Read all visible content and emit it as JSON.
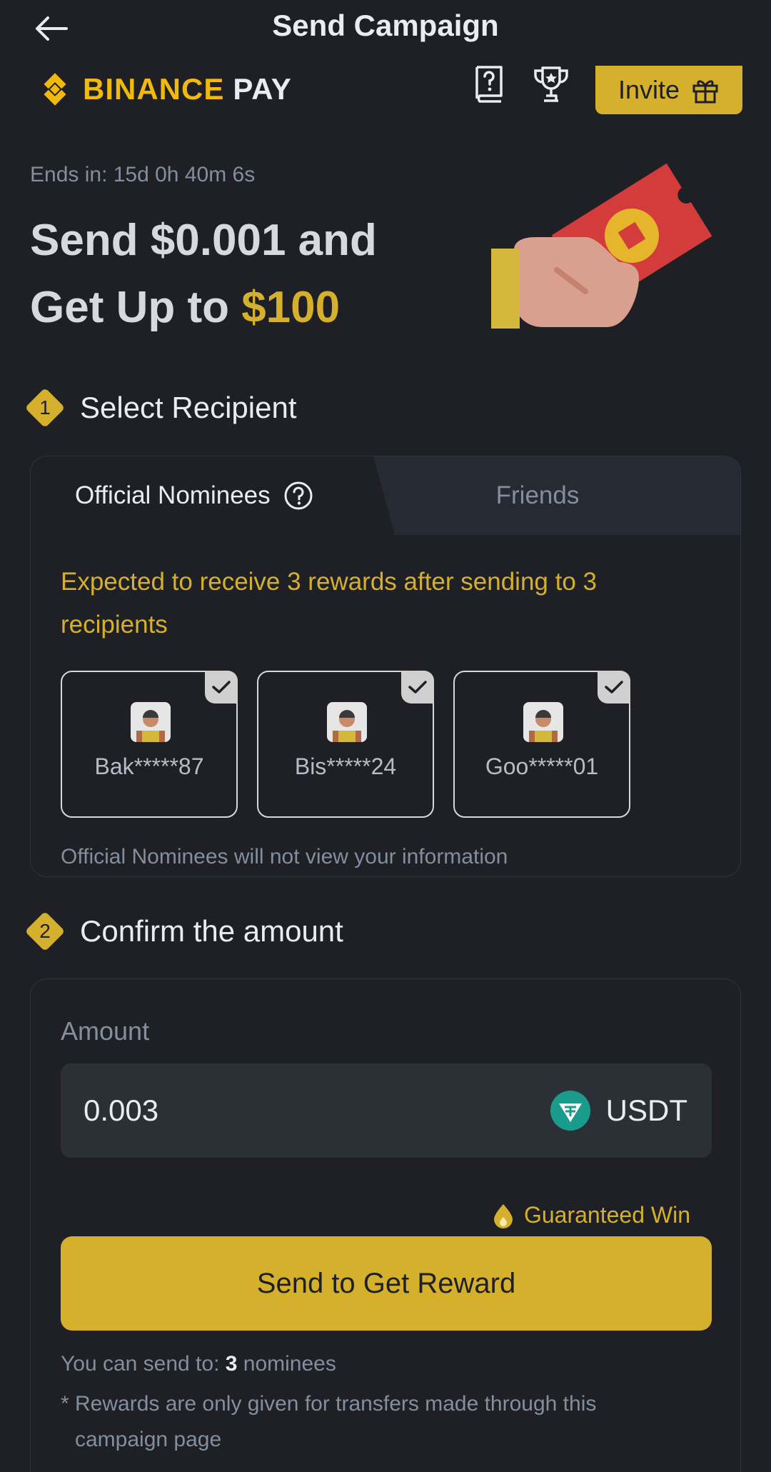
{
  "header": {
    "title": "Send Campaign"
  },
  "brand": {
    "name_primary": "BINANCE",
    "name_secondary": "PAY",
    "invite_label": "Invite"
  },
  "hero": {
    "ends_in": "Ends in: 15d 0h 40m 6s",
    "line1": "Send $0.001 and",
    "line2_prefix": "Get Up to ",
    "line2_highlight": "$100"
  },
  "step1": {
    "number": "1",
    "label": "Select Recipient"
  },
  "tabs": {
    "official": "Official Nominees",
    "friends": "Friends"
  },
  "recipients": {
    "expected": "Expected to receive 3 rewards after sending to 3 recipients",
    "nominees": [
      {
        "name": "Bak*****87"
      },
      {
        "name": "Bis*****24"
      },
      {
        "name": "Goo*****01"
      }
    ],
    "note": "Official Nominees will not view your information"
  },
  "step2": {
    "number": "2",
    "label": "Confirm the amount"
  },
  "amount": {
    "label": "Amount",
    "value": "0.003",
    "currency": "USDT",
    "guaranteed": "Guaranteed Win",
    "send_button": "Send to Get Reward",
    "can_send_prefix": "You can send to: ",
    "can_send_count": "3",
    "can_send_suffix": " nominees",
    "rewards_star": "*",
    "rewards_note": "Rewards are only given for transfers made through this campaign page"
  },
  "colors": {
    "accent": "#d4b02c",
    "background": "#1e2026",
    "tether": "#1a9b8c"
  }
}
